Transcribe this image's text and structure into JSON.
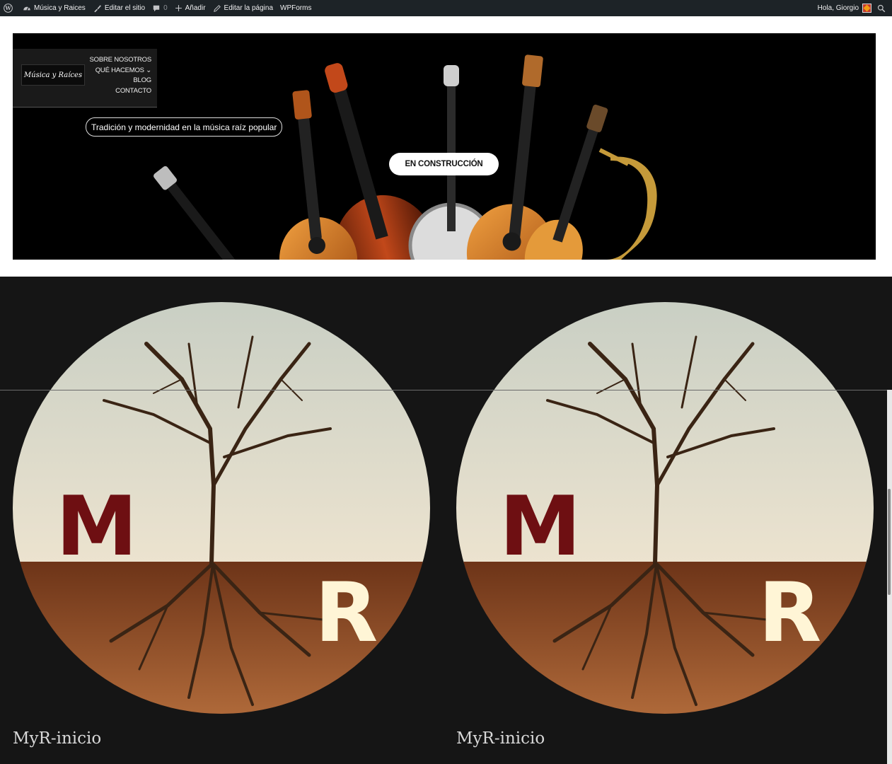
{
  "admin_bar": {
    "site_name": "Música y Raices",
    "edit_site": "Editar el sitio",
    "comments_count": "0",
    "add_new": "Añadir",
    "edit_page": "Editar la página",
    "wpforms": "WPForms",
    "greeting": "Hola, Giorgio"
  },
  "header": {
    "logo_text": "Música y Raíces",
    "nav": [
      {
        "label": "SOBRE NOSOTROS"
      },
      {
        "label": "QUÉ HACEMOS ⌄"
      },
      {
        "label": "BLOG"
      },
      {
        "label": "CONTACTO"
      }
    ]
  },
  "hero": {
    "tagline": "Tradición y modernidad en la música raíz popular",
    "cta": "EN CONSTRUCCIÓN"
  },
  "gallery": {
    "items": [
      {
        "caption": "MyR-inicio",
        "letters": [
          "M",
          "R"
        ]
      },
      {
        "caption": "MyR-inicio",
        "letters": [
          "M",
          "R"
        ]
      }
    ]
  },
  "colors": {
    "admin_bar": "#1d2327",
    "gallery_bg": "#151515",
    "logo_letter_m": "#6e0f12",
    "logo_letter_r": "#fff5d6",
    "soil": "#7a4222",
    "sky": "#d8d8c8"
  }
}
